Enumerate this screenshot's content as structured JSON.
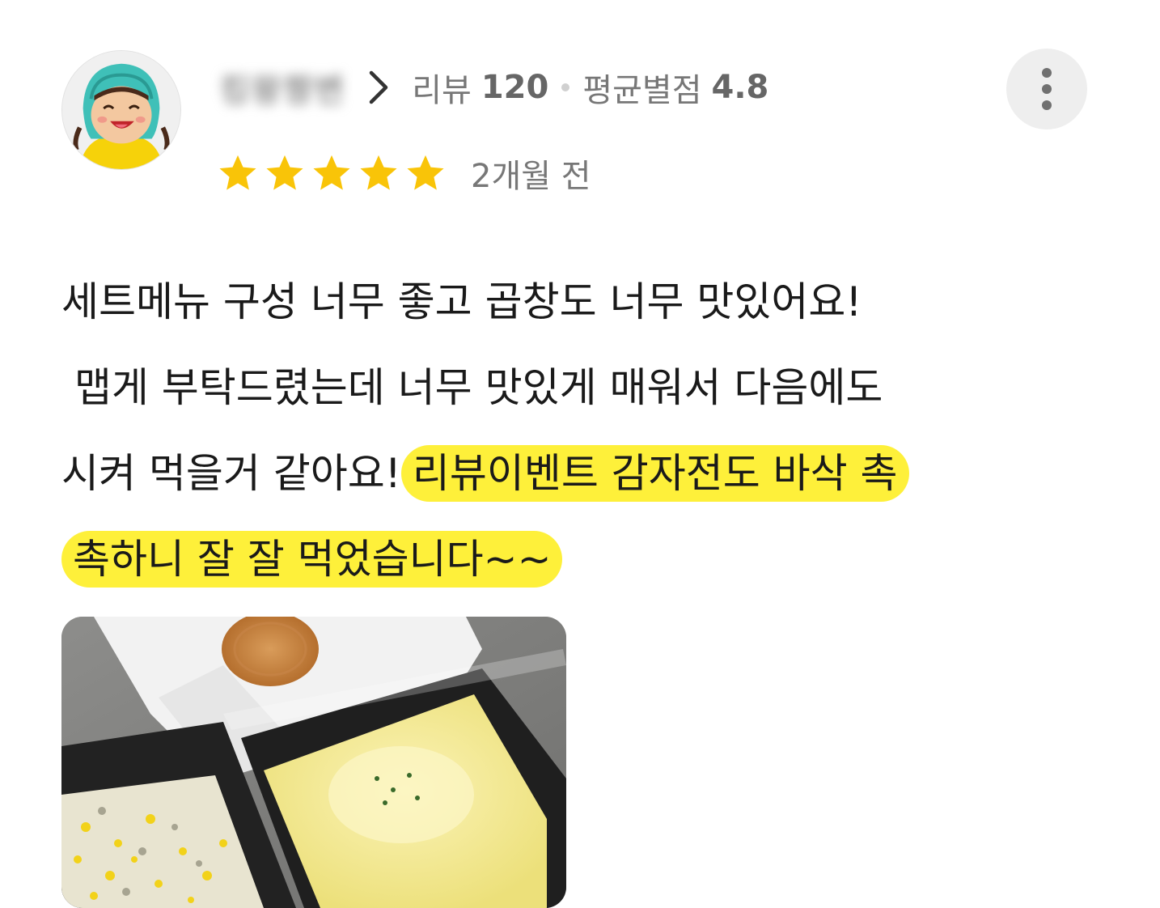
{
  "reviewer": {
    "name": "킹왕짱변",
    "review_count_label": "리뷰",
    "review_count": "120",
    "avg_rating_label": "평균별점",
    "avg_rating": "4.8",
    "avatar_icon": "cartoon-avatar-icon"
  },
  "rating": {
    "stars": 5,
    "star_color": "#f9c408",
    "time_ago": "2개월 전"
  },
  "review": {
    "line1": "세트메뉴 구성 너무 좋고 곱창도 너무 맛있어요!",
    "line2": " 맵게 부탁드렸는데 너무 맛있게 매워서 다음에도",
    "line3_plain": "시켜 먹을거 같아요!",
    "line3_highlight": "리뷰이벤트 감자전도 바삭 촉",
    "line4_highlight": "촉하니 잘 잘 먹었습니다~~",
    "highlight_color": "#fef03a"
  },
  "menu": {
    "more_icon": "more-vertical-icon"
  },
  "photo": {
    "icon": "food-photo-image"
  }
}
